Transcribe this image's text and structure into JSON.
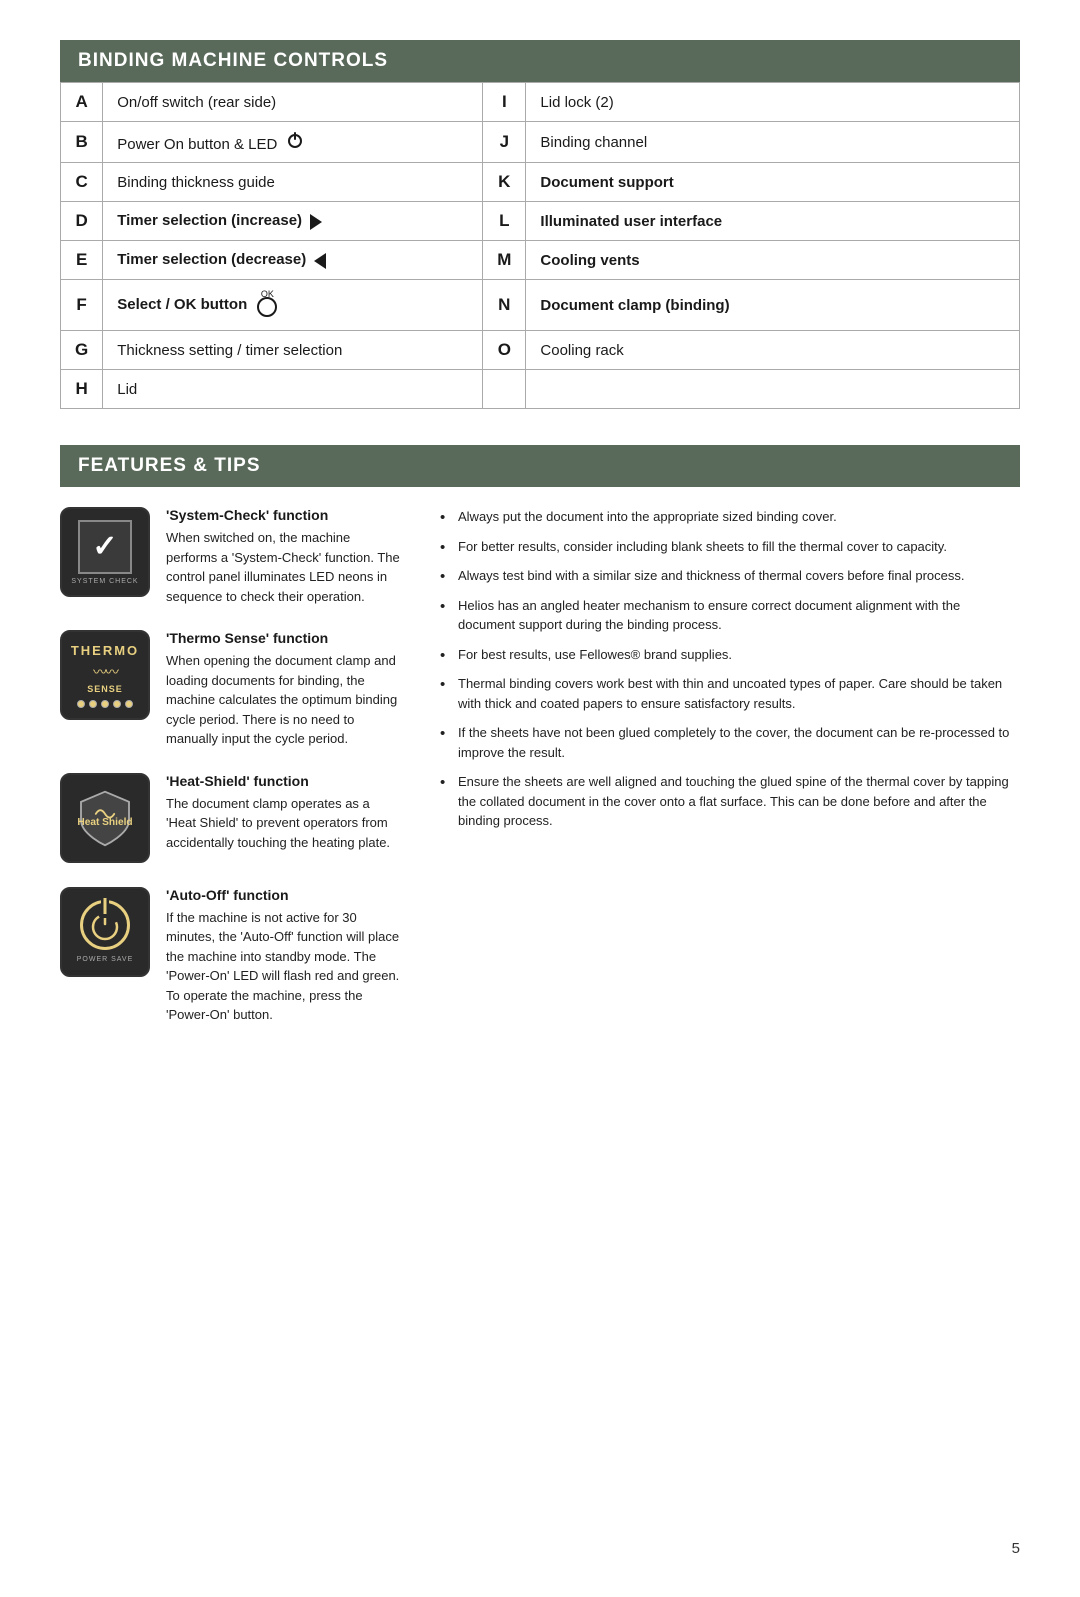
{
  "page": {
    "number": "5"
  },
  "binding_controls": {
    "title": "BINDING MACHINE CONTROLS",
    "rows": [
      {
        "left_letter": "A",
        "left_desc": "On/off switch (rear side)",
        "right_letter": "I",
        "right_desc": "Lid lock (2)"
      },
      {
        "left_letter": "B",
        "left_desc": "Power On button & LED",
        "right_letter": "J",
        "right_desc": "Binding channel"
      },
      {
        "left_letter": "C",
        "left_desc": "Binding thickness guide",
        "right_letter": "K",
        "right_desc": "Document support"
      },
      {
        "left_letter": "D",
        "left_desc": "Timer selection (increase)",
        "right_letter": "L",
        "right_desc": "Illuminated user interface"
      },
      {
        "left_letter": "E",
        "left_desc": "Timer selection (decrease)",
        "right_letter": "M",
        "right_desc": "Cooling vents"
      },
      {
        "left_letter": "F",
        "left_desc": "Select / OK button",
        "right_letter": "N",
        "right_desc": "Document clamp (binding)"
      },
      {
        "left_letter": "G",
        "left_desc": "Thickness setting / timer selection",
        "right_letter": "O",
        "right_desc": "Cooling rack"
      },
      {
        "left_letter": "H",
        "left_desc": "Lid",
        "right_letter": "",
        "right_desc": ""
      }
    ]
  },
  "features": {
    "title": "FEATURES & TIPS",
    "items": [
      {
        "id": "system-check",
        "title": "'System-Check' function",
        "label": "SYSTEM CHECK",
        "desc": "When switched on, the machine performs a 'System-Check' function. The control panel illuminates LED neons in sequence to check their operation."
      },
      {
        "id": "thermo-sense",
        "title": "'Thermo Sense' function",
        "label": "THERMO SENSE",
        "desc": "When opening the document clamp and loading documents for binding, the machine calculates the optimum binding cycle period. There is no need to manually input the cycle period."
      },
      {
        "id": "heat-shield",
        "title": "'Heat-Shield' function",
        "label": "Heat Shield",
        "desc": "The document clamp operates as a 'Heat Shield' to prevent operators from accidentally touching the heating plate."
      },
      {
        "id": "auto-off",
        "title": "'Auto-Off' function",
        "label": "POWER SAVE",
        "desc": "If the machine is not active for 30 minutes, the 'Auto-Off' function will place the machine into standby mode. The 'Power-On' LED will flash red and green. To operate the machine, press the 'Power-On' button."
      }
    ],
    "tips": [
      "Always put the document into the appropriate sized binding cover.",
      "For better results, consider including blank sheets to fill the thermal cover to capacity.",
      "Always test bind with a similar size and thickness of thermal covers before final process.",
      "Helios has an angled heater mechanism to ensure correct document alignment with the document support during the binding process.",
      "For best results, use Fellowes® brand supplies.",
      "Thermal binding covers work best with thin and uncoated types of paper. Care should be taken with thick and coated papers to ensure satisfactory results.",
      "If the sheets have not been glued completely to the cover, the document can be re-processed to improve the result.",
      "Ensure the sheets are well aligned and touching the glued spine of the thermal cover by tapping the collated document in the cover onto a flat surface. This can be done before and after the binding process."
    ]
  }
}
